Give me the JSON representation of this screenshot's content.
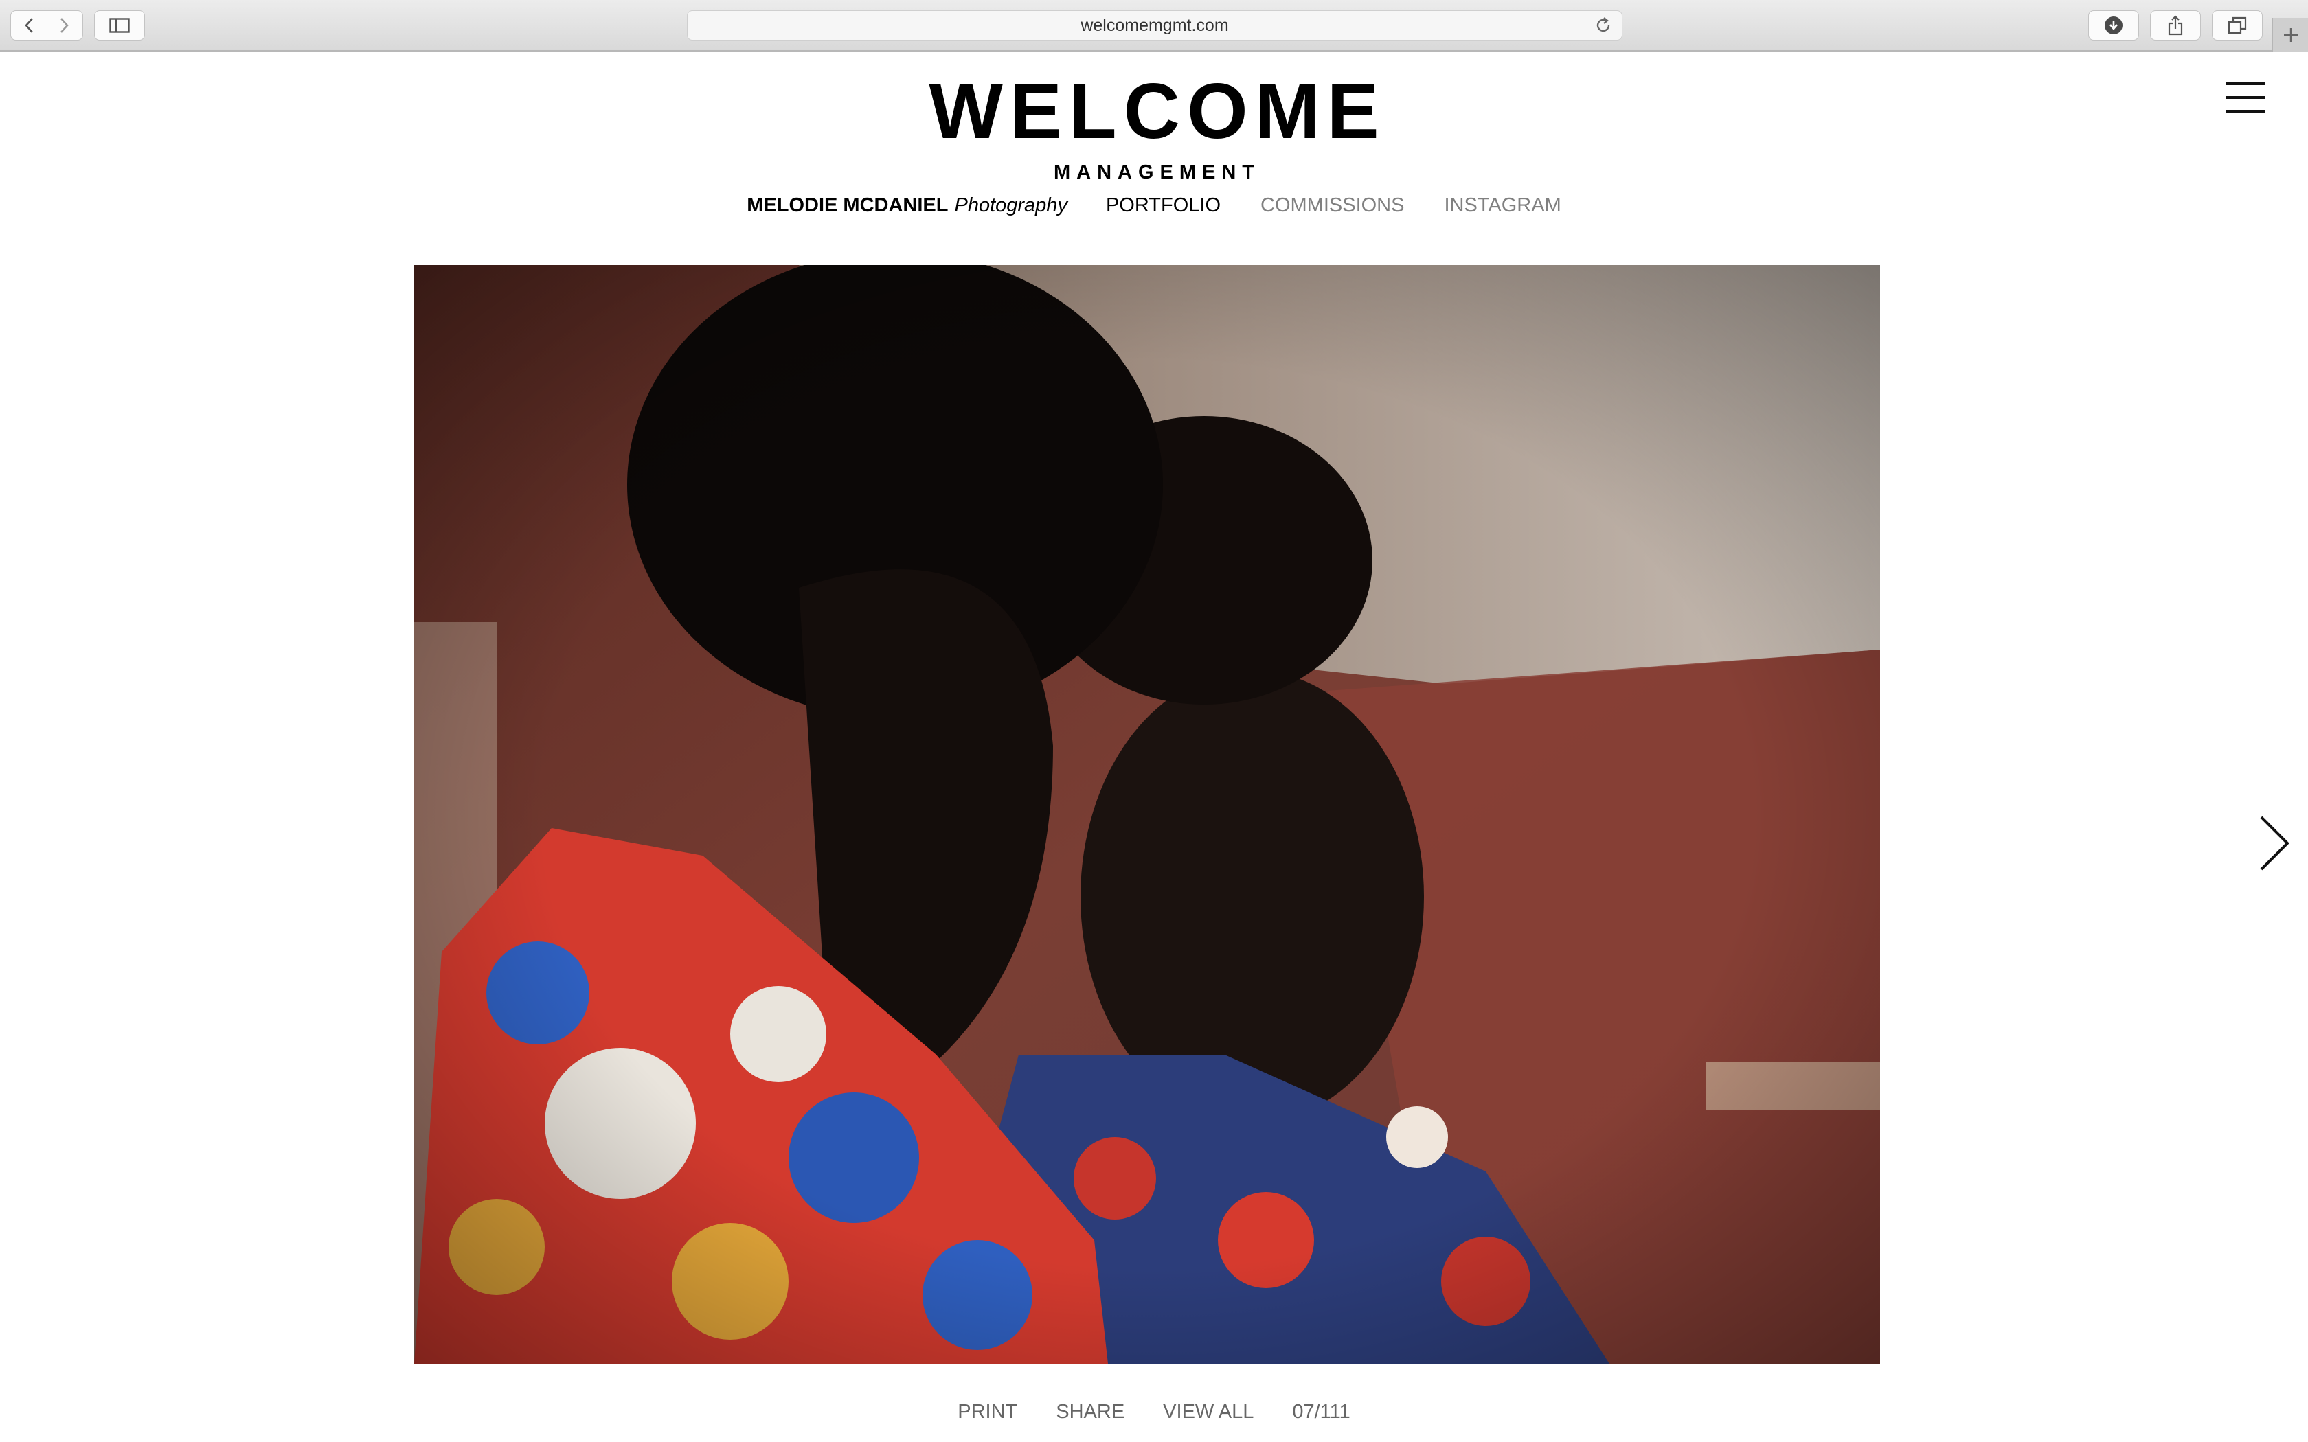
{
  "browser": {
    "url": "welcomemgmt.com",
    "icons": [
      "back-icon",
      "forward-icon",
      "sidebar-icon",
      "reload-icon",
      "download-icon",
      "share-icon",
      "tabs-icon",
      "plus-icon"
    ]
  },
  "header": {
    "logo_main": "WELCOME",
    "logo_sub": "MANAGEMENT"
  },
  "subnav": {
    "artist_name": "MELODIE MCDANIEL",
    "artist_discipline": "Photography",
    "portfolio": "PORTFOLIO",
    "commissions": "COMMISSIONS",
    "instagram": "INSTAGRAM"
  },
  "photo": {
    "description_icon": "photo"
  },
  "footer": {
    "print": "PRINT",
    "share": "SHARE",
    "view_all": "VIEW ALL",
    "counter": "07/111"
  },
  "colors": {
    "text": "#000000",
    "muted": "#808080",
    "footer": "#666666"
  }
}
